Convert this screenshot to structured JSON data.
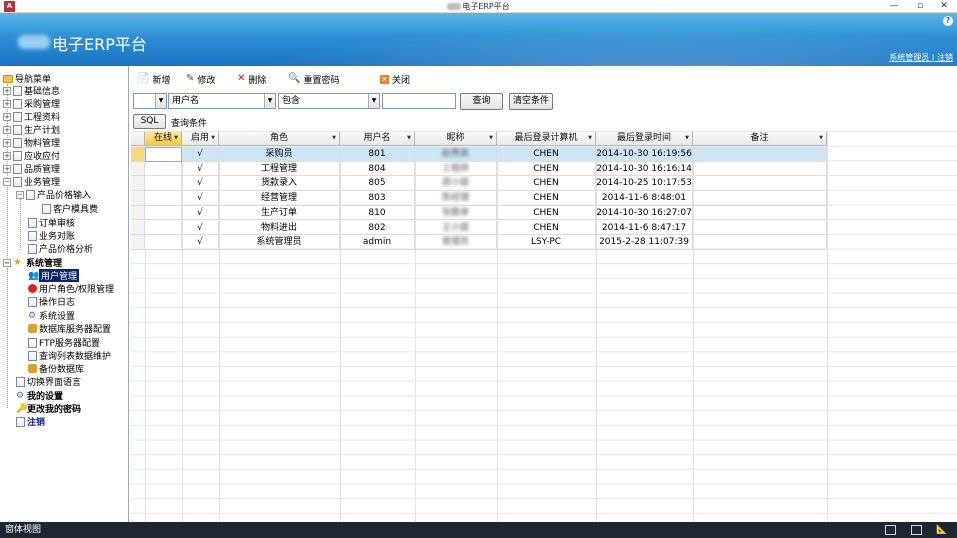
{
  "window": {
    "title": "电子ERP平台",
    "app_icon": "A",
    "minimize": "—",
    "restore": "▫",
    "close": "✕"
  },
  "banner": {
    "title": "电子ERP平台",
    "help": "?",
    "links": "系统管理员 | 注销"
  },
  "sidebar": {
    "header": "导航菜单",
    "items": {
      "basic": "基础信息",
      "purchase": "采购管理",
      "engineering": "工程资料",
      "production": "生产计划",
      "material": "物料管理",
      "receivable": "应收应付",
      "quality": "品质管理",
      "business": "业务管理",
      "price_input": "产品价格输入",
      "mold_fee": "客户模具费",
      "order_review": "订单审核",
      "reconcile": "业务对账",
      "price_analysis": "产品价格分析",
      "system": "系统管理",
      "user_mgmt": "用户管理",
      "roles": "用户角色/权限管理",
      "oplog": "操作日志",
      "settings": "系统设置",
      "db_server": "数据库服务器配置",
      "ftp": "FTP服务器配置",
      "query_maint": "查询列表数据维护",
      "backup": "备份数据库",
      "language": "切换界面语言",
      "my_settings": "我的设置",
      "password": "更改我的密码",
      "logout": "注销"
    }
  },
  "toolbar": {
    "new": "新增",
    "edit": "修改",
    "delete": "删除",
    "reset_pwd": "重置密码",
    "close": "关闭"
  },
  "filter": {
    "field": "用户名",
    "operator": "包含",
    "value": "",
    "query_btn": "查询",
    "clear_btn": "清空条件",
    "sql_btn": "SQL",
    "condition_label": "查询条件"
  },
  "grid": {
    "columns": [
      "在线",
      "启用",
      "角色",
      "用户名",
      "昵称",
      "最后登录计算机",
      "最后登录时间",
      "备注"
    ],
    "rows": [
      {
        "online": "",
        "enabled": "√",
        "role": "采购员",
        "user": "801",
        "nick": "赵秀英",
        "pc": "CHEN",
        "time": "2014-10-30 16:19:56",
        "note": ""
      },
      {
        "online": "",
        "enabled": "√",
        "role": "工程管理",
        "user": "804",
        "nick": "工程师",
        "pc": "CHEN",
        "time": "2014-10-30 16:16:14",
        "note": ""
      },
      {
        "online": "",
        "enabled": "√",
        "role": "货款录入",
        "user": "805",
        "nick": "周小姐",
        "pc": "CHEN",
        "time": "2014-10-25 10:17:53",
        "note": ""
      },
      {
        "online": "",
        "enabled": "√",
        "role": "经营管理",
        "user": "803",
        "nick": "陈经理",
        "pc": "CHEN",
        "time": "2014-11-6 8:48:01",
        "note": ""
      },
      {
        "online": "",
        "enabled": "√",
        "role": "生产订单",
        "user": "810",
        "nick": "张跟单",
        "pc": "CHEN",
        "time": "2014-10-30 16:27:07",
        "note": ""
      },
      {
        "online": "",
        "enabled": "√",
        "role": "物料进出",
        "user": "802",
        "nick": "王小姐",
        "pc": "CHEN",
        "time": "2014-11-6 8:47:17",
        "note": ""
      },
      {
        "online": "",
        "enabled": "√",
        "role": "系统管理员",
        "user": "admin",
        "nick": "管理员",
        "pc": "LSY-PC",
        "time": "2015-2-28 11:07:39",
        "note": ""
      }
    ]
  },
  "statusbar": {
    "text": "窗体视图"
  }
}
